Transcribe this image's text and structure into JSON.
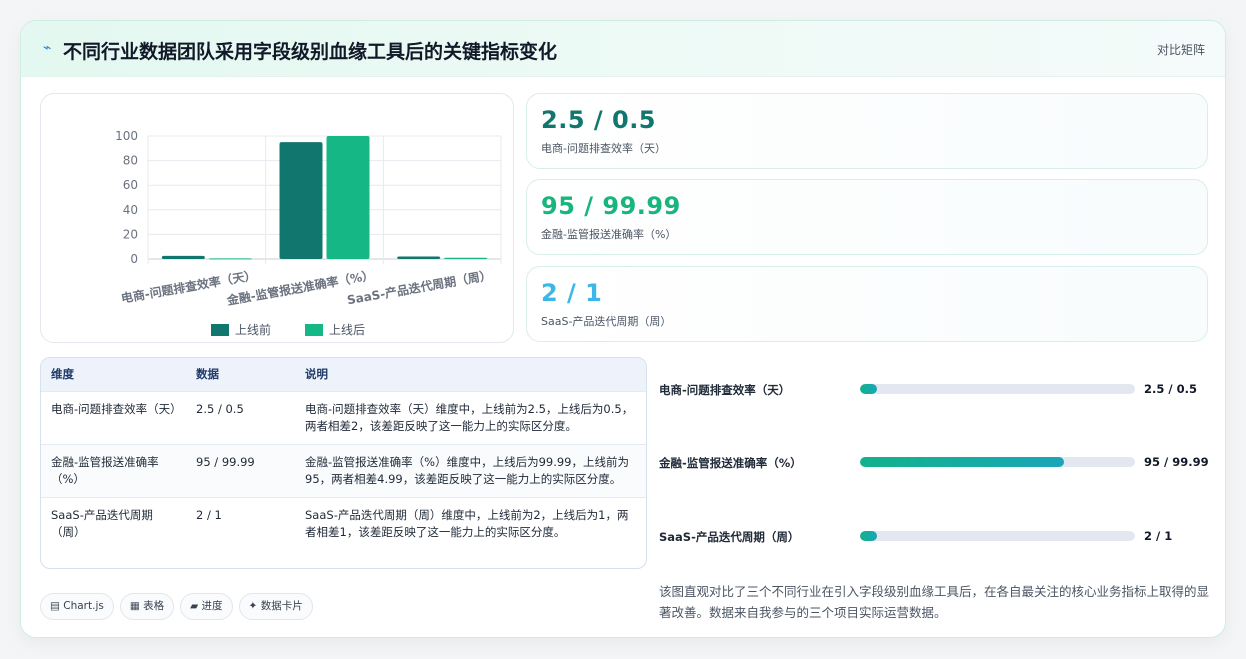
{
  "header": {
    "icon": "bolt-icon",
    "title": "不同行业数据团队采用字段级别血缘工具后的关键指标变化",
    "tag": "对比矩阵"
  },
  "chart_data": {
    "type": "bar",
    "categories": [
      "电商-问题排查效率（天）",
      "金融-监管报送准确率（%）",
      "SaaS-产品迭代周期（周）"
    ],
    "series": [
      {
        "name": "上线前",
        "values": [
          2.5,
          95,
          2
        ],
        "color": "#11766d"
      },
      {
        "name": "上线后",
        "values": [
          0.5,
          99.99,
          1
        ],
        "color": "#15b885"
      }
    ],
    "yticks": [
      0,
      20,
      40,
      60,
      80,
      100
    ],
    "ylim": [
      0,
      100
    ],
    "legend": "bottom"
  },
  "kpis": [
    {
      "value": "2.5 / 0.5",
      "label": "电商-问题排查效率（天）"
    },
    {
      "value": "95 / 99.99",
      "label": "金融-监管报送准确率（%）"
    },
    {
      "value": "2 / 1",
      "label": "SaaS-产品迭代周期（周）"
    }
  ],
  "table": {
    "headers": [
      "维度",
      "数据",
      "说明"
    ],
    "rows": [
      {
        "dim": "电商-问题排查效率（天）",
        "data": "2.5 / 0.5",
        "note": "电商-问题排查效率（天）维度中，上线前为2.5，上线后为0.5，两者相差2，该差距反映了这一能力上的实际区分度。"
      },
      {
        "dim": "金融-监管报送准确率（%）",
        "data": "95 / 99.99",
        "note": "金融-监管报送准确率（%）维度中，上线后为99.99，上线前为95，两者相差4.99，该差距反映了这一能力上的实际区分度。"
      },
      {
        "dim": "SaaS-产品迭代周期（周）",
        "data": "2 / 1",
        "note": "SaaS-产品迭代周期（周）维度中，上线前为2，上线后为1，两者相差1，该差距反映了这一能力上的实际区分度。"
      }
    ]
  },
  "progress": [
    {
      "label": "电商-问题排查效率（天）",
      "value": "2.5 / 0.5",
      "fraction": 0.06
    },
    {
      "label": "金融-监管报送准确率（%）",
      "value": "95 / 99.99",
      "fraction": 0.74
    },
    {
      "label": "SaaS-产品迭代周期（周）",
      "value": "2 / 1",
      "fraction": 0.06
    }
  ],
  "chips": [
    {
      "icon": "chart-icon",
      "glyph": "▤",
      "label": "Chart.js"
    },
    {
      "icon": "table-icon",
      "glyph": "▦",
      "label": "表格"
    },
    {
      "icon": "progress-icon",
      "glyph": "▰",
      "label": "进度"
    },
    {
      "icon": "sparkle-icon",
      "glyph": "✦",
      "label": "数据卡片"
    }
  ],
  "description": "该图直观对比了三个不同行业在引入字段级别血缘工具后，在各自最关注的核心业务指标上取得的显著改善。数据来自我参与的三个项目实际运营数据。"
}
